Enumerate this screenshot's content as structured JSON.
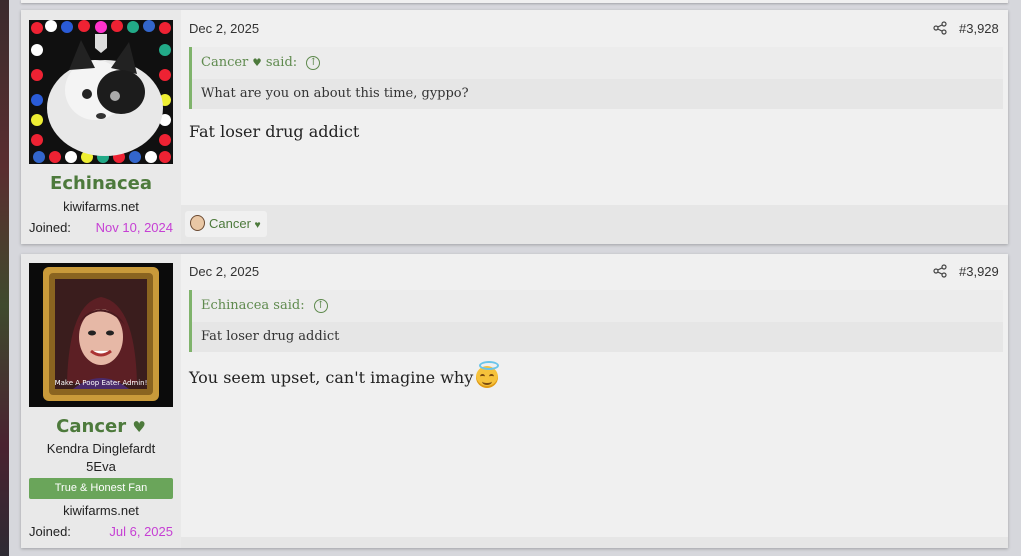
{
  "posts": [
    {
      "username": "Echinacea",
      "site": "kiwifarms.net",
      "joined_label": "Joined:",
      "joined_date": "Nov 10, 2024",
      "date": "Dec 2, 2025",
      "post_number": "#3,928",
      "quote": {
        "author": "Cancer",
        "said": "said:",
        "text": "What are you on about this time, gyppo?"
      },
      "message": "Fat loser drug addict",
      "reaction": {
        "user": "Cancer"
      }
    },
    {
      "username": "Cancer",
      "custom_title_1": "Kendra Dinglefardt",
      "custom_title_2": "5Eva",
      "banner": "True & Honest Fan",
      "site": "kiwifarms.net",
      "joined_label": "Joined:",
      "joined_date": "Jul 6, 2025",
      "date": "Dec 2, 2025",
      "post_number": "#3,929",
      "quote": {
        "author": "Echinacea",
        "said": "said:",
        "text": "Fat loser drug addict"
      },
      "message": "You seem upset, can't imagine why",
      "avatar_caption": "Make A Poop Eater Admin!"
    }
  ],
  "colors": {
    "username": "#4d7a3c",
    "joined": "#c640d4",
    "quote_border": "#7fb36b",
    "banner": "#6aa55a"
  },
  "icons": {
    "share": "share-icon",
    "heart": "heart-icon",
    "jump": "arrow-up-circle-icon",
    "emoji": "smiling-face-with-halo-icon"
  }
}
